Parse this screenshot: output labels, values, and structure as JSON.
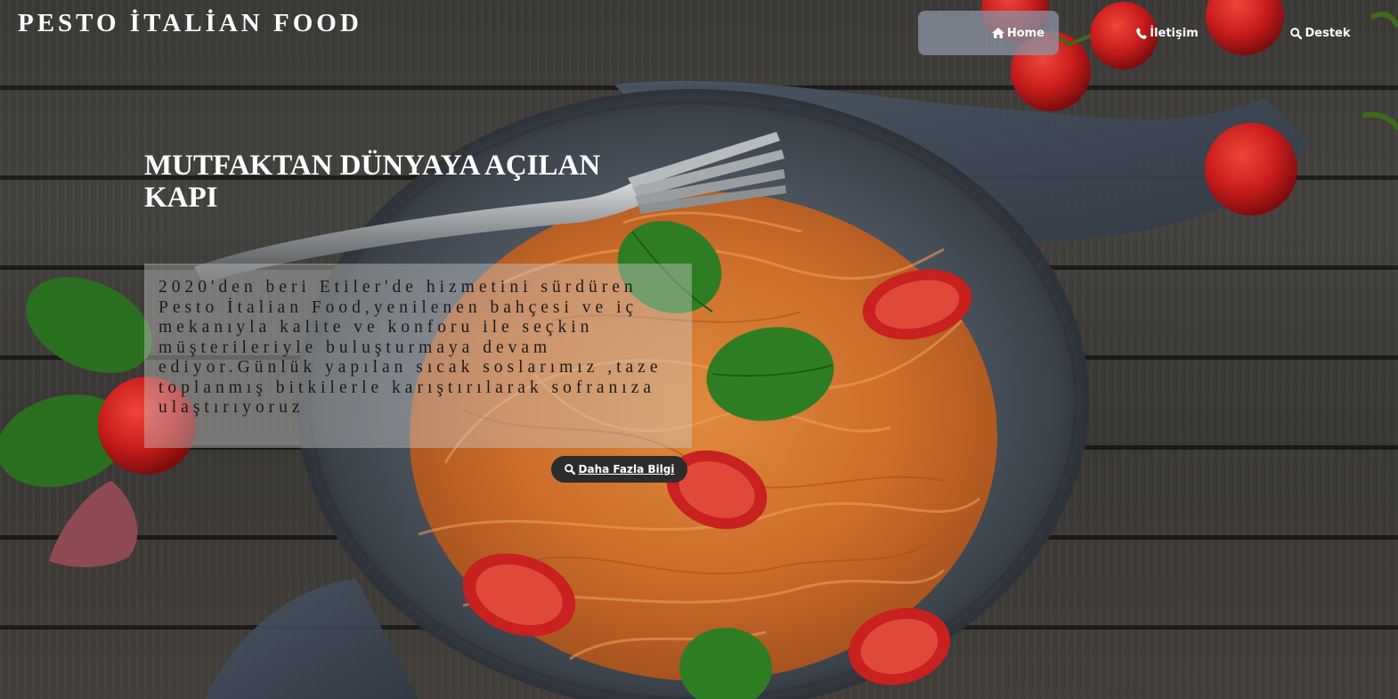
{
  "header": {
    "brand": "PESTO İTALİAN FOOD",
    "nav": [
      {
        "label": "Home",
        "icon": "home-icon"
      },
      {
        "label": "İletişim",
        "icon": "phone-icon"
      },
      {
        "label": "Destek",
        "icon": "search-icon"
      }
    ]
  },
  "hero": {
    "title": "MUTFAKTAN DÜNYAYA AÇILAN KAPI",
    "description": "2020'den beri Etiler'de hizmetini sürdüren Pesto İtalian Food,yenilenen bahçesi ve iç mekanıyla kalite ve konforu ile seçkin müşterileriyle buluşturmaya devam ediyor.Günlük yapılan sıcak soslarımız ,taze toplanmış bitkilerle karıştırılarak sofranıza ulaştırıyoruz",
    "button": {
      "label": "Daha Fazla Bilgi",
      "icon": "search-icon"
    }
  },
  "colors": {
    "home_tab_bg": "#8c96a5",
    "button_bg": "#2c2c2c",
    "text_box_bg": "#cdcdcd",
    "wood": "#3e3c39",
    "plate": "#4a525c",
    "tomato": "#c81c1c",
    "basil": "#2f7d23",
    "pasta": "#d9792e"
  }
}
